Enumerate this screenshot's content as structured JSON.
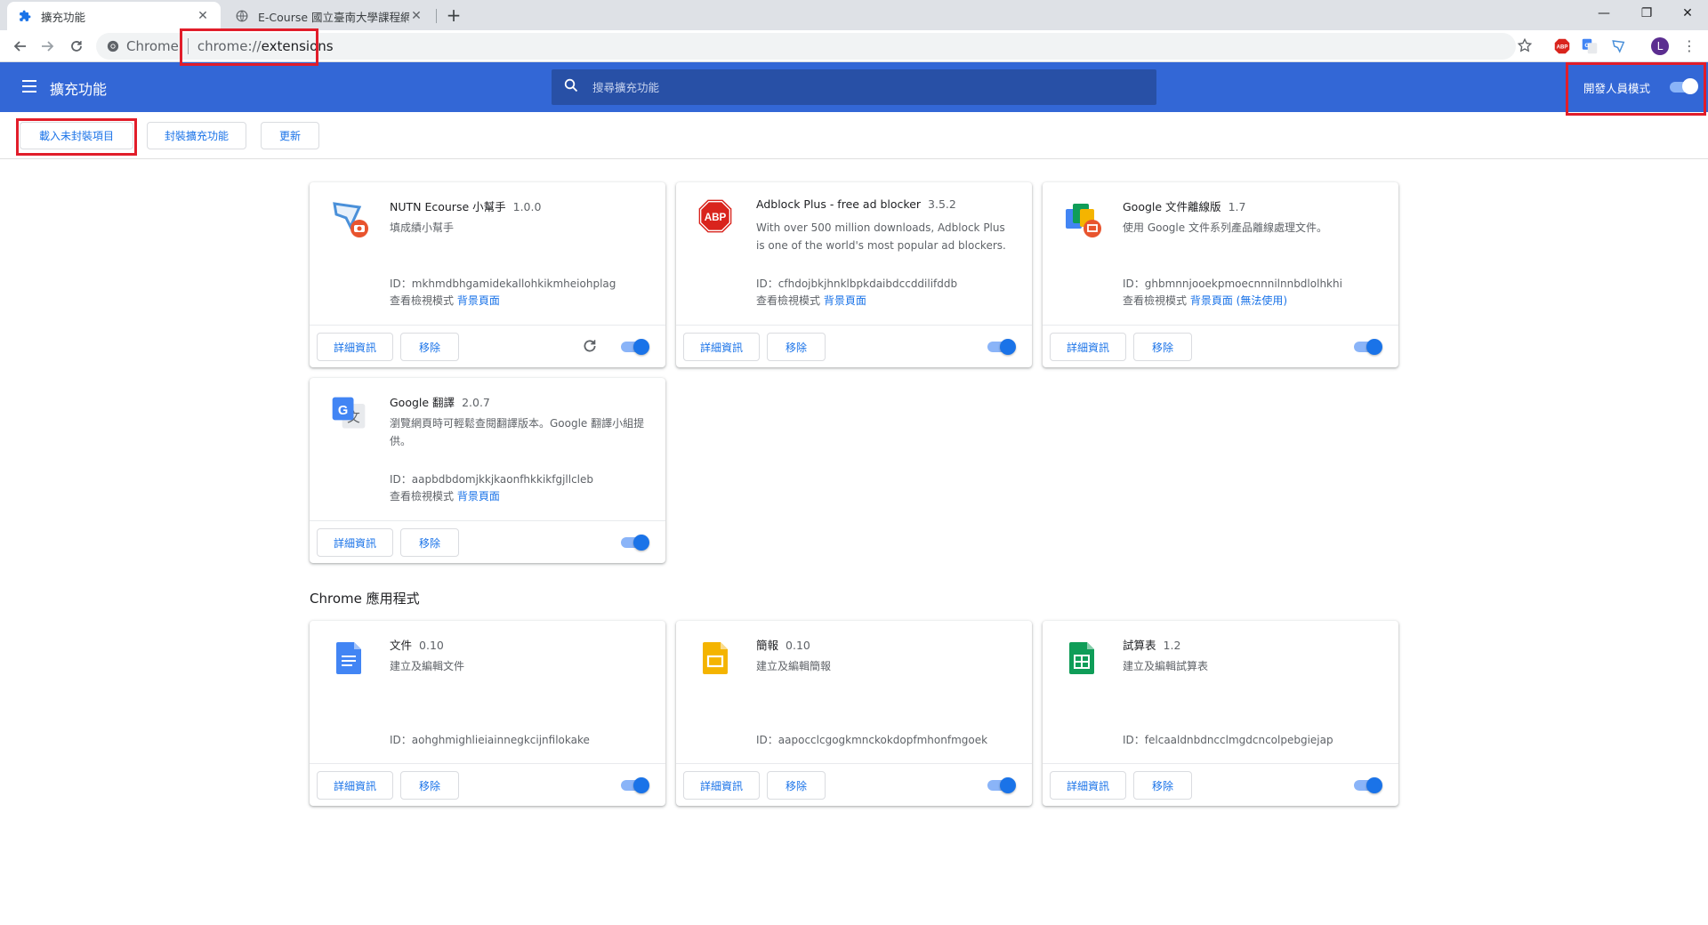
{
  "tabs": [
    {
      "title": "擴充功能",
      "close": "✕"
    },
    {
      "title": "E-Course 國立臺南大學課程網站",
      "close": "✕"
    }
  ],
  "new_tab": "+",
  "window_controls": {
    "minimize": "—",
    "restore": "❐",
    "close": "✕"
  },
  "omnibox": {
    "chip": "Chrome",
    "scheme": "chrome://",
    "path": "extensions"
  },
  "toolbar_extensions": [
    "abp-icon",
    "google-translate-icon",
    "nutn-ecourse-icon"
  ],
  "profile_initial": "L",
  "header": {
    "title": "擴充功能",
    "search_placeholder": "搜尋擴充功能",
    "dev_mode_label": "開發人員模式",
    "dev_mode_on": true
  },
  "dev_buttons": {
    "load_unpacked": "載入未封裝項目",
    "pack": "封裝擴充功能",
    "update": "更新"
  },
  "extensions": [
    {
      "name": "NUTN Ecourse 小幫手",
      "version": "1.0.0",
      "description": "填成績小幫手",
      "id": "ID：mkhmdbhgamidekallohkikmheiohplag",
      "view_label": "查看檢視模式",
      "view_link": "背景頁面",
      "details": "詳細資訊",
      "remove": "移除",
      "enabled": true
    },
    {
      "name": "Adblock Plus - free ad blocker",
      "version": "3.5.2",
      "description": "With over 500 million downloads, Adblock Plus is one of the world's most popular ad blockers.",
      "id": "ID：cfhdojbkjhnklbpkdaibdccddilifddb",
      "view_label": "查看檢視模式",
      "view_link": "背景頁面",
      "details": "詳細資訊",
      "remove": "移除",
      "enabled": true
    },
    {
      "name": "Google 文件離線版",
      "version": "1.7",
      "description": "使用 Google 文件系列產品離線處理文件。",
      "id": "ID：ghbmnnjooekpmoecnnnilnnbdlolhkhi",
      "view_label": "查看檢視模式",
      "view_link": "背景頁面 (無法使用)",
      "details": "詳細資訊",
      "remove": "移除",
      "enabled": true
    },
    {
      "name": "Google 翻譯",
      "version": "2.0.7",
      "description": "瀏覽網頁時可輕鬆查閱翻譯版本。Google 翻譯小組提供。",
      "id": "ID：aapbdbdomjkkjkaonfhkkikfgjllcleb",
      "view_label": "查看檢視模式",
      "view_link": "背景頁面",
      "details": "詳細資訊",
      "remove": "移除",
      "enabled": true
    }
  ],
  "apps_section_title": "Chrome 應用程式",
  "apps": [
    {
      "name": "文件",
      "version": "0.10",
      "description": "建立及編輯文件",
      "id": "ID：aohghmighlieiainnegkcijnfilokake",
      "details": "詳細資訊",
      "remove": "移除",
      "enabled": true,
      "color": "#4285f4"
    },
    {
      "name": "簡報",
      "version": "0.10",
      "description": "建立及編輯簡報",
      "id": "ID：aapocclcgogkmnckokdopfmhonfmgoek",
      "details": "詳細資訊",
      "remove": "移除",
      "enabled": true,
      "color": "#f4b400"
    },
    {
      "name": "試算表",
      "version": "1.2",
      "description": "建立及編輯試算表",
      "id": "ID：felcaaldnbdncclmgdcncolpebgiejap",
      "details": "詳細資訊",
      "remove": "移除",
      "enabled": true,
      "color": "#0f9d58"
    }
  ],
  "colors": {
    "header": "#3367d6",
    "accent": "#1a73e8",
    "highlight": "#e11d2a"
  }
}
